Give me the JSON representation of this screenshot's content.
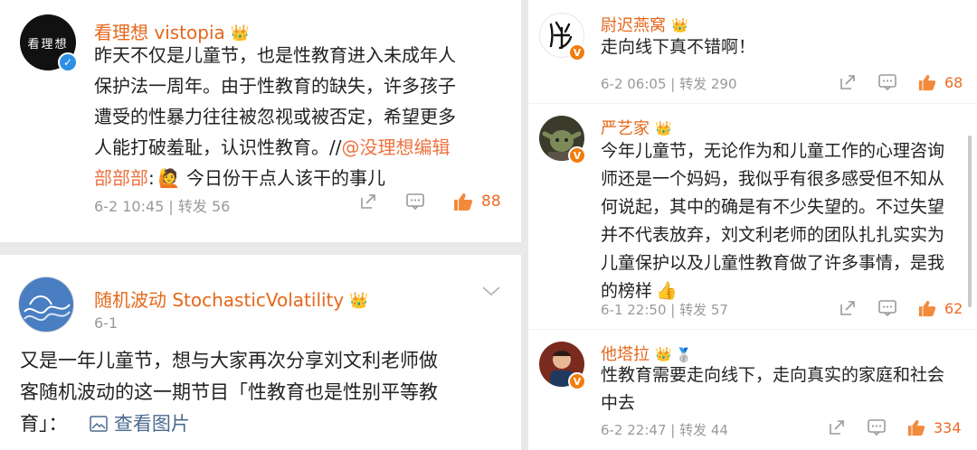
{
  "posts_left": {
    "post1": {
      "avatar_text": "看理想",
      "name": "看理想 vistopia",
      "text_lines": [
        "昨天不仅是儿童节，也是性教育进入未成年人",
        "保护法一周年。由于性教育的缺失，许多孩子",
        "遭受的性暴力往往被忽视或被否定，希望更多",
        "人能打破羞耻，认识性教育。//"
      ],
      "mention": "@没理想编辑",
      "mention_cont": "部部部",
      "after_mention": ":",
      "tail": " 今日份干点人该干的事儿",
      "meta": "6-2 10:45 | 转发 56",
      "likes": "88"
    },
    "post2": {
      "name": "随机波动 StochasticVolatility",
      "date": "6-1",
      "text_lines": [
        "又是一年儿童节，想与大家再次分享刘文利老师做",
        "客随机波动的这一期节目「性教育也是性别平等教"
      ],
      "text_last": "育」：",
      "view_images": "查看图片"
    }
  },
  "comments_right": [
    {
      "name": "尉迟燕窝",
      "text_lines": [
        "走向线下真不错啊！"
      ],
      "meta": "6-2 06:05 | 转发 290",
      "likes": "68"
    },
    {
      "name": "严艺家",
      "text_lines": [
        "今年儿童节，无论作为和儿童工作的心理咨询",
        "师还是一个妈妈，我似乎有很多感受但不知从",
        "何说起，其中的确是有不少失望的。不过失望",
        "并不代表放弃，刘文利老师的团队扎扎实实为",
        "儿童保护以及儿童性教育做了许多事情，是我",
        "的榜样"
      ],
      "meta": "6-1 22:50 | 转发 57",
      "likes": "62"
    },
    {
      "name": "他塔拉",
      "text_lines": [
        "性教育需要走向线下，走向真实的家庭和社会",
        "中去"
      ],
      "meta": "6-2 22:47 | 转发 44",
      "likes": "334"
    }
  ],
  "colors": {
    "name_orange": "#e5671a",
    "like_orange": "#ee6a24",
    "meta_gray": "#9a9a9a",
    "verified_blue": "#2d8fe6",
    "verified_orange": "#f07d0e"
  },
  "icons": [
    "verified-badge-icon",
    "crown-badge-icon",
    "share-icon",
    "comment-icon",
    "like-icon",
    "chevron-down-icon",
    "image-icon",
    "thumbs-up-emoji-icon",
    "medal-icon"
  ]
}
